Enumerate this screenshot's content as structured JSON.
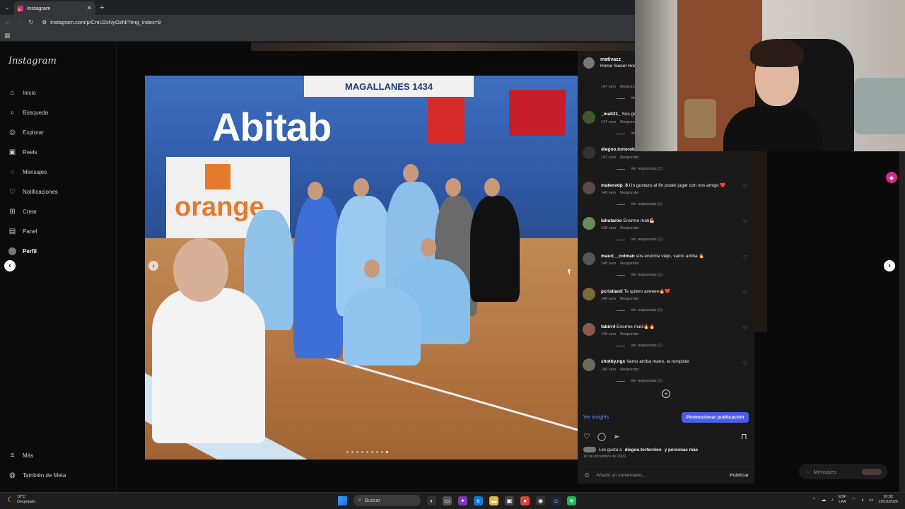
{
  "browser": {
    "tab_title": "Instagram",
    "url": "instagram.com/p/CmU2xNyOzhl/?img_index=9"
  },
  "sidebar": {
    "logo": "Instagram",
    "items": [
      {
        "label": "Inicio",
        "icon": "home-icon"
      },
      {
        "label": "Búsqueda",
        "icon": "search-icon"
      },
      {
        "label": "Explorar",
        "icon": "compass-icon"
      },
      {
        "label": "Reels",
        "icon": "reels-icon"
      },
      {
        "label": "Mensajes",
        "icon": "messenger-icon"
      },
      {
        "label": "Notificaciones",
        "icon": "heart-icon"
      },
      {
        "label": "Crear",
        "icon": "plus-square-icon"
      },
      {
        "label": "Panel",
        "icon": "dashboard-icon"
      },
      {
        "label": "Perfil",
        "icon": "avatar"
      }
    ],
    "bottom": [
      {
        "label": "Más",
        "icon": "menu-icon"
      },
      {
        "label": "También de Meta",
        "icon": "meta-icon"
      }
    ]
  },
  "photo": {
    "top_banner": "MAGALLANES 1434",
    "brand_1": "Abitab",
    "brand_2": "orange",
    "carousel_dots": 9,
    "active_dot": 9
  },
  "post": {
    "author": "mativazz_",
    "location": "Home Sweet Home",
    "comments": [
      {
        "user": "",
        "text": "",
        "time": "147 sem",
        "reply_label": "Responder",
        "replies": "Ver respuestas (1)"
      },
      {
        "user": "_mati21_",
        "text": "Sos grande",
        "time": "147 sem",
        "reply_label": "Responder",
        "replies": "Ver respuestas (1)"
      },
      {
        "user": "diegoo.torteroloo",
        "text": "",
        "time": "147 sem",
        "reply_label": "Responder",
        "replies": "Ver respuestas (1)"
      },
      {
        "user": "mateovdp_6",
        "text": "Un gustazo al fin poder jugar con vos amigo ❤️",
        "time": "148 sem",
        "reply_label": "Responder",
        "replies": "Ver respuestas (1)"
      },
      {
        "user": "lahutaroo",
        "text": "Enorme mati💪🏻",
        "time": "148 sem",
        "reply_label": "Responder",
        "replies": "Ver respuestas (1)"
      },
      {
        "user": "mauri__colman",
        "text": "sos enorme viejo, vamo arriba 🔥",
        "time": "148 sem",
        "reply_label": "Responder",
        "replies": "Ver respuestas (1)"
      },
      {
        "user": "pcristianii",
        "text": "Te quiero aveeee🔥❤️",
        "time": "148 sem",
        "reply_label": "Responder",
        "replies": "Ver respuestas (1)"
      },
      {
        "user": "fabirr4",
        "text": "Enorme matii🔥🔥",
        "time": "148 sem",
        "reply_label": "Responder",
        "replies": "Ver respuestas (1)"
      },
      {
        "user": "shotby.ngx",
        "text": "Vamo arriba mano, la rompiste",
        "time": "148 sem",
        "reply_label": "Responder",
        "replies": "Ver respuestas (1)"
      }
    ],
    "insights_label": "Ver insights",
    "promote_label": "Promocionar publicación",
    "likes_prefix": "Les gusta a ",
    "likes_user": "diegoo.torteroloo",
    "likes_suffix": " y personas más",
    "date": "18 de diciembre de 2022",
    "comment_placeholder": "Añade un comentario...",
    "publish_label": "Publicar"
  },
  "messages_pill": {
    "label": "Mensajes"
  },
  "taskbar": {
    "temperature": "18°C",
    "weather": "Despejado",
    "search_label": "Buscar",
    "lang_1": "ESP",
    "lang_2": "LAA",
    "time": "20:32",
    "date": "19/10/2025"
  },
  "colors": {
    "accent": "#4a5bf0",
    "insights_link": "#6e8fff",
    "panel_bg": "#1a1a1a"
  }
}
